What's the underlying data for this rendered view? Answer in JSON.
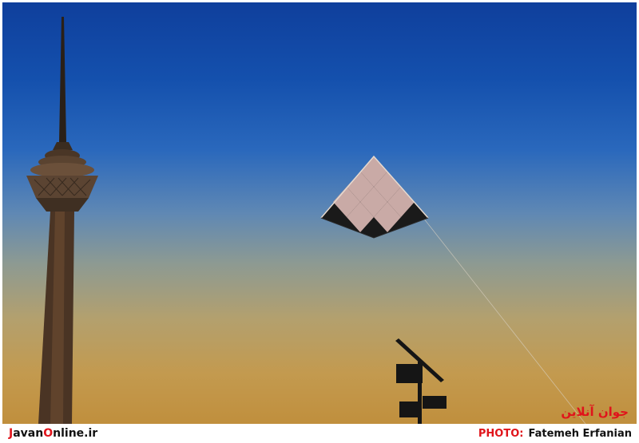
{
  "watermark": "جوان آنلاین",
  "footer": {
    "site_j": "J",
    "site_avan": "avan",
    "site_o": "O",
    "site_rest": "nline.ir",
    "photo_label": "PHOTO:",
    "photographer": "Fatemeh Erfanian"
  },
  "colors": {
    "accent": "#e0141b",
    "sky_top": "#0f3f9c",
    "sky_bottom": "#c08f3d"
  }
}
